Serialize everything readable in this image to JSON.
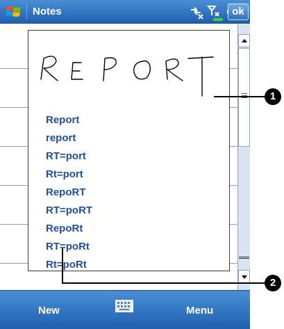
{
  "titlebar": {
    "app_title": "Notes",
    "ok_label": "ok",
    "status_icons": [
      "connectivity-icon",
      "signal-off-icon",
      "volume-icon"
    ]
  },
  "popup": {
    "alternates": [
      "Report",
      "report",
      "RT=port",
      "Rt=port",
      "RepoRT",
      "RT=poRT",
      "RepoRt",
      "RT=poRt",
      "Rt=poRt"
    ]
  },
  "cmdbar": {
    "left_label": "New",
    "right_label": "Menu"
  },
  "callouts": [
    {
      "number": "1"
    },
    {
      "number": "2"
    }
  ],
  "colors": {
    "bar_blue": "#2d6fc0",
    "alternate_text": "#1f4f9c"
  }
}
